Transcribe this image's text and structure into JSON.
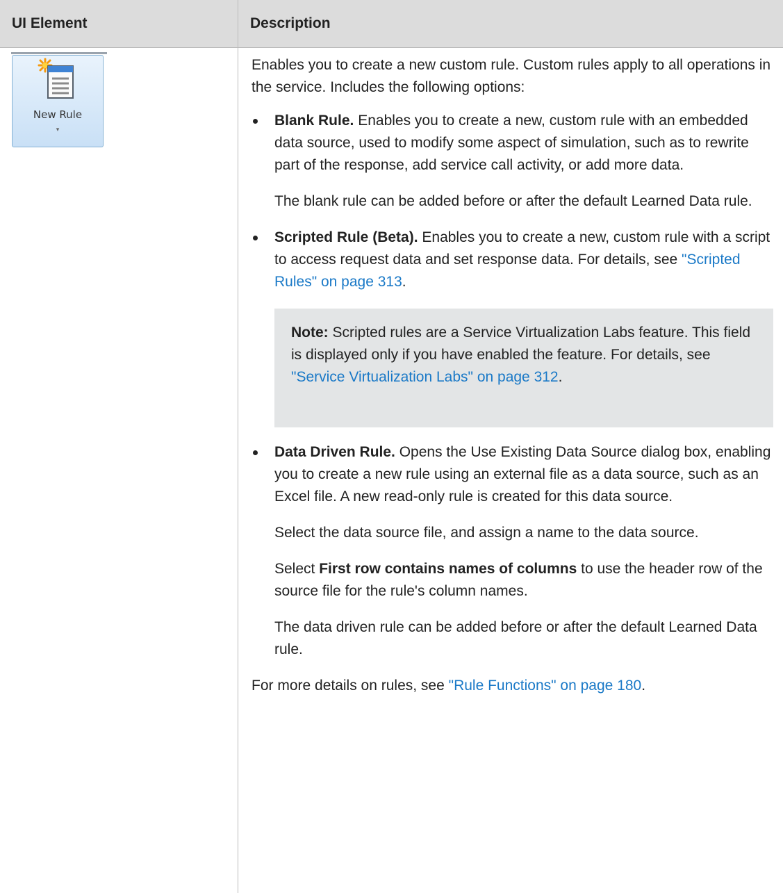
{
  "table": {
    "headers": {
      "element": "UI Element",
      "description": "Description"
    }
  },
  "button": {
    "label": "New Rule",
    "icon": "new-rule-icon",
    "arrow": "▾"
  },
  "desc": {
    "intro": "Enables you to create a new custom rule. Custom rules apply to all operations in the service. Includes the following options:",
    "blank": {
      "title": "Blank Rule.",
      "text": " Enables you to create a new, custom rule with an embedded data source, used to modify some aspect of simulation, such as to rewrite part of the response, add service call activity, or add more data.",
      "note": "The blank rule can be added before or after the default Learned Data rule."
    },
    "scripted": {
      "title": "Scripted Rule (Beta).",
      "text": " Enables you to create a new, custom rule with a script to access request data and set response data. For details, see ",
      "link": "\"Scripted Rules\" on page 313",
      "end": "."
    },
    "note_box": {
      "label": "Note:",
      "text": " Scripted rules are a Service Virtualization Labs feature. This field is displayed only if you have enabled the feature. For details, see ",
      "link": "\"Service Virtualization Labs\" on page 312",
      "end": "."
    },
    "data_driven": {
      "title": "Data Driven Rule.",
      "text": " Opens the Use Existing Data Source dialog box, enabling you to create a new rule using an external file as a data source, such as an Excel file. A new read-only rule is created for this data source.",
      "select": "Select the data source file, and assign a name to the data source.",
      "first_row_pre": "Select ",
      "first_row_bold": "First row contains names of columns",
      "first_row_post": " to use the header row of the source file for the rule's column names.",
      "note": "The data driven rule can be added before or after the default Learned Data rule."
    },
    "footer": {
      "text": "For more details on rules, see ",
      "link": "\"Rule Functions\" on page 180",
      "end": "."
    }
  }
}
